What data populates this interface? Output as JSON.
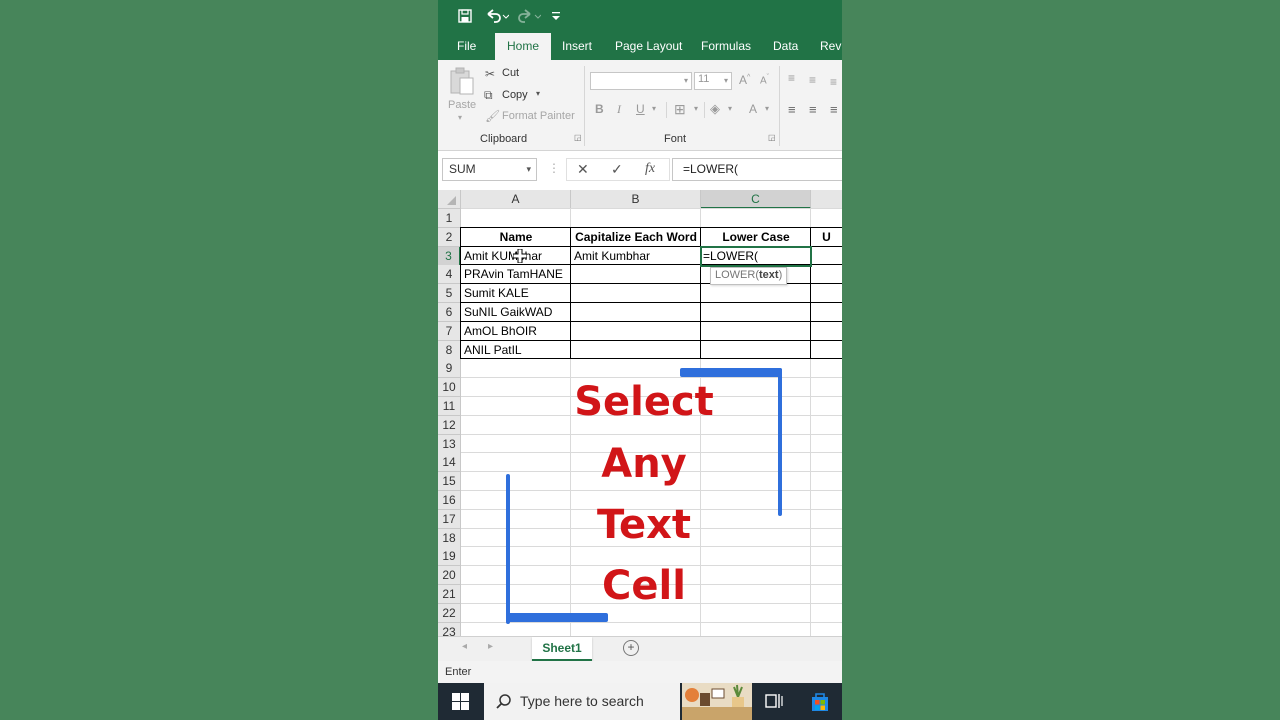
{
  "quick_access": {
    "save_icon": "save-icon",
    "undo_icon": "undo-icon",
    "redo_icon": "redo-icon",
    "customize_icon": "customize-qat-icon"
  },
  "ribbon_tabs": [
    "File",
    "Home",
    "Insert",
    "Page Layout",
    "Formulas",
    "Data",
    "Revi"
  ],
  "active_tab": "Home",
  "clipboard": {
    "paste": "Paste",
    "cut": "Cut",
    "copy": "Copy",
    "format_painter": "Format Painter",
    "group_label": "Clipboard"
  },
  "font": {
    "font_name": "",
    "font_size": "11",
    "bold": "B",
    "italic": "I",
    "underline": "U",
    "grow": "A",
    "shrink": "A",
    "font_color": "A",
    "group_label": "Font"
  },
  "formula_bar": {
    "name_box": "SUM",
    "cancel": "✕",
    "enter": "✓",
    "fx": "fx",
    "content": "=LOWER("
  },
  "columns": [
    "A",
    "B",
    "C",
    "U"
  ],
  "rows": [
    "1",
    "2",
    "3",
    "4",
    "5",
    "6",
    "7",
    "8",
    "9",
    "10",
    "11",
    "12",
    "13",
    "14",
    "15",
    "16",
    "17",
    "18",
    "19",
    "20",
    "21",
    "22",
    "23"
  ],
  "table": {
    "headers": [
      "Name",
      "Capitalize Each Word",
      "Lower Case",
      "U"
    ],
    "names": [
      "Amit KUMbhar",
      "PRAvin TamHANE",
      "Sumit KALE",
      "SuNIL GaikWAD",
      "AmOL BhOIR",
      "ANIL PatIL"
    ],
    "capitalized_first": "Amit Kumbhar",
    "active_formula": "=LOWER("
  },
  "tooltip": {
    "fn": "LOWER(",
    "arg": "text",
    "close": ")"
  },
  "overlay": [
    "Select",
    "Any",
    "Text",
    "Cell"
  ],
  "sheet_tab": "Sheet1",
  "status": "Enter",
  "taskbar": {
    "search_placeholder": "Type here to search"
  },
  "colors": {
    "excel_green": "#217346",
    "overlay_red": "#d11518",
    "bracket_blue": "#2f6fdc",
    "background": "#47855a"
  }
}
